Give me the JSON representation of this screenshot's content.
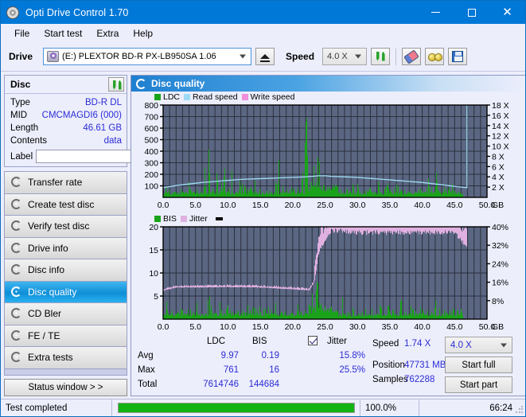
{
  "window": {
    "title": "Opti Drive Control 1.70",
    "icon": "disc-icon",
    "minimize_label": "minimize",
    "maximize_label": "maximize",
    "close_label": "close"
  },
  "menu": {
    "items": [
      "File",
      "Start test",
      "Extra",
      "Help"
    ]
  },
  "toolbar": {
    "drive_label": "Drive",
    "drive_value": "(E:)  PLEXTOR BD-R  PX-LB950SA 1.06",
    "eject_icon": "eject-icon",
    "speed_label": "Speed",
    "speed_value": "4.0 X",
    "refresh_icon": "refresh-icon",
    "erase_icon": "eraser-icon",
    "glasses_icon": "glasses-icon",
    "save_icon": "save-icon"
  },
  "disc": {
    "title": "Disc",
    "refresh_icon": "refresh-icon",
    "rows": [
      {
        "key": "Type",
        "value": "BD-R DL"
      },
      {
        "key": "MID",
        "value": "CMCMAGDI6 (000)"
      },
      {
        "key": "Length",
        "value": "46.61 GB"
      },
      {
        "key": "Contents",
        "value": "data"
      }
    ],
    "label_key": "Label",
    "label_value": "",
    "label_placeholder": "",
    "label_icon": "cd-icon"
  },
  "nav": {
    "items": [
      {
        "label": "Transfer rate",
        "active": false
      },
      {
        "label": "Create test disc",
        "active": false
      },
      {
        "label": "Verify test disc",
        "active": false
      },
      {
        "label": "Drive info",
        "active": false
      },
      {
        "label": "Disc info",
        "active": false
      },
      {
        "label": "Disc quality",
        "active": true
      },
      {
        "label": "CD Bler",
        "active": false
      },
      {
        "label": "FE / TE",
        "active": false
      },
      {
        "label": "Extra tests",
        "active": false
      }
    ],
    "status_window_label": "Status window > >"
  },
  "panel": {
    "title": "Disc quality",
    "icon": "disc-quality-icon"
  },
  "stats": {
    "col_headers": [
      "LDC",
      "BIS"
    ],
    "jitter_label": "Jitter",
    "jitter_checked": true,
    "rows": [
      {
        "key": "Avg",
        "ldc": "9.97",
        "bis": "0.19",
        "jitter": "15.8%"
      },
      {
        "key": "Max",
        "ldc": "761",
        "bis": "16",
        "jitter": "25.5%"
      },
      {
        "key": "Total",
        "ldc": "7614746",
        "bis": "144684",
        "jitter": ""
      }
    ],
    "speed_key": "Speed",
    "speed_value": "1.74 X",
    "position_key": "Position",
    "position_value": "47731 MB",
    "samples_key": "Samples",
    "samples_value": "762288",
    "speed_select_value": "4.0 X",
    "start_full_label": "Start full",
    "start_part_label": "Start part"
  },
  "statusbar": {
    "message": "Test completed",
    "progress_percent": 100,
    "progress_label": "100.0%",
    "elapsed": "66:24"
  },
  "chart_data": [
    {
      "type": "area",
      "id": "ldc-chart",
      "title": "",
      "xlabel": "GB",
      "ylabel": "",
      "xlim": [
        0,
        50
      ],
      "ylim": [
        0,
        800
      ],
      "y2lim": [
        0,
        18
      ],
      "xticks": [
        0.0,
        5.0,
        10.0,
        15.0,
        20.0,
        25.0,
        30.0,
        35.0,
        40.0,
        45.0,
        50.0
      ],
      "xticklabels": [
        "0.0",
        "5.0",
        "10.0",
        "15.0",
        "20.0",
        "25.0",
        "30.0",
        "35.0",
        "40.0",
        "45.0",
        "50.0"
      ],
      "yticks": [
        100,
        200,
        300,
        400,
        500,
        600,
        700,
        800
      ],
      "yticklabels": [
        "100",
        "200",
        "300",
        "400",
        "500",
        "600",
        "700",
        "800"
      ],
      "y2ticks": [
        2,
        4,
        6,
        8,
        10,
        12,
        14,
        16,
        18
      ],
      "y2ticklabels": [
        "2 X",
        "4 X",
        "6 X",
        "8 X",
        "10 X",
        "12 X",
        "14 X",
        "16 X",
        "18 X"
      ],
      "grid": true,
      "plot_bg": "#5b6782",
      "legend": [
        {
          "name": "LDC",
          "color": "#1aa31a"
        },
        {
          "name": "Read speed",
          "color": "#9edcf5"
        },
        {
          "name": "Write speed",
          "color": "#f08fdc"
        }
      ],
      "series": [
        {
          "name": "LDC",
          "kind": "spikes",
          "color": "#1aa31a",
          "x": [
            0.1,
            0.4,
            0.7,
            1.0,
            1.3,
            1.6,
            1.9,
            2.2,
            2.5,
            2.8,
            3.1,
            3.4,
            3.7,
            4.0,
            4.3,
            4.6,
            4.9,
            5.2,
            5.5,
            5.8,
            6.1,
            6.4,
            6.7,
            7.0,
            7.3,
            7.6,
            7.9,
            8.2,
            8.5,
            8.8,
            9.1,
            9.4,
            9.7,
            10.0,
            10.3,
            10.6,
            10.9,
            11.2,
            11.5,
            11.8,
            12.1,
            12.4,
            12.7,
            13.0,
            13.3,
            13.6,
            13.9,
            14.2,
            14.5,
            14.8,
            15.1,
            15.4,
            15.7,
            16.0,
            16.3,
            16.6,
            16.9,
            17.2,
            17.5,
            17.8,
            18.1,
            18.4,
            18.7,
            19.0,
            19.3,
            19.6,
            19.9,
            20.2,
            20.5,
            20.8,
            21.1,
            21.4,
            21.7,
            22.0,
            22.3,
            22.6,
            22.9,
            23.2,
            23.5,
            23.8,
            24.1,
            24.4,
            24.7,
            25.0,
            25.3,
            25.6,
            25.9,
            26.2,
            26.5,
            26.8,
            27.1,
            27.4,
            27.7,
            28.0,
            28.3,
            28.6,
            28.9,
            29.2,
            29.5,
            29.8,
            30.1,
            30.4,
            30.7,
            31.0,
            31.3,
            31.6,
            31.9,
            32.2,
            32.5,
            32.8,
            33.1,
            33.4,
            33.7,
            34.0,
            34.3,
            34.6,
            34.9,
            35.2,
            35.5,
            35.8,
            36.1,
            36.4,
            36.7,
            37.0,
            37.3,
            37.6,
            37.9,
            38.2,
            38.5,
            38.8,
            39.1,
            39.4,
            39.7,
            40.0,
            40.3,
            40.6,
            40.9,
            41.2,
            41.5,
            41.8,
            42.1,
            42.4,
            42.7,
            43.0,
            43.3,
            43.6,
            43.9,
            44.2,
            44.5,
            44.8,
            45.1,
            45.4,
            45.7,
            46.0,
            46.3,
            46.6
          ],
          "values": [
            55,
            120,
            40,
            90,
            35,
            160,
            45,
            70,
            30,
            110,
            40,
            85,
            35,
            200,
            45,
            60,
            30,
            300,
            50,
            75,
            40,
            260,
            55,
            400,
            60,
            90,
            45,
            230,
            50,
            180,
            40,
            300,
            60,
            140,
            35,
            250,
            45,
            80,
            40,
            170,
            50,
            300,
            45,
            95,
            40,
            130,
            55,
            200,
            45,
            100,
            35,
            180,
            50,
            240,
            45,
            90,
            40,
            310,
            55,
            340,
            50,
            120,
            40,
            200,
            60,
            160,
            45,
            110,
            50,
            190,
            45,
            260,
            55,
            700,
            450,
            350,
            760,
            400,
            300,
            650,
            250,
            420,
            160,
            150,
            120,
            90,
            80,
            70,
            100,
            130,
            85,
            95,
            250,
            110,
            70,
            90,
            210,
            160,
            120,
            100,
            230,
            80,
            95,
            70,
            110,
            90,
            130,
            85,
            70,
            75,
            95,
            200,
            80,
            70,
            120,
            260,
            90,
            110,
            75,
            95,
            230,
            200,
            250,
            85,
            70,
            100,
            130,
            160,
            90,
            80,
            110,
            70,
            95,
            140,
            75,
            90,
            210,
            80,
            70,
            100,
            190,
            130,
            85,
            70,
            95,
            120,
            80,
            75,
            110,
            90,
            70,
            85,
            100,
            75,
            60
          ]
        },
        {
          "name": "Read speed",
          "kind": "line",
          "color": "#9edcf5",
          "x": [
            0,
            2,
            4,
            6,
            8,
            10,
            12,
            14,
            16,
            18,
            20,
            22,
            23,
            24,
            25,
            26,
            28,
            30,
            32,
            34,
            36,
            38,
            40,
            42,
            44,
            46,
            46.9,
            46.9
          ],
          "values": [
            1.9,
            2.3,
            2.6,
            2.9,
            3.1,
            3.3,
            3.5,
            3.6,
            3.7,
            3.8,
            3.9,
            4.0,
            4.1,
            4.2,
            4.2,
            4.1,
            4.0,
            3.9,
            3.7,
            3.5,
            3.3,
            3.1,
            2.9,
            2.6,
            2.3,
            2.0,
            1.9,
            18.0
          ]
        }
      ]
    },
    {
      "type": "area",
      "id": "bis-jitter-chart",
      "title": "",
      "xlabel": "GB",
      "ylabel": "",
      "xlim": [
        0,
        50
      ],
      "ylim": [
        0,
        20
      ],
      "y2lim": [
        0,
        40
      ],
      "xticks": [
        0.0,
        5.0,
        10.0,
        15.0,
        20.0,
        25.0,
        30.0,
        35.0,
        40.0,
        45.0,
        50.0
      ],
      "xticklabels": [
        "0.0",
        "5.0",
        "10.0",
        "15.0",
        "20.0",
        "25.0",
        "30.0",
        "35.0",
        "40.0",
        "45.0",
        "50.0"
      ],
      "yticks": [
        5,
        10,
        15,
        20
      ],
      "yticklabels": [
        "5",
        "10",
        "15",
        "20"
      ],
      "y2ticks": [
        8,
        16,
        24,
        32,
        40
      ],
      "y2ticklabels": [
        "8%",
        "16%",
        "24%",
        "32%",
        "40%"
      ],
      "grid": true,
      "plot_bg": "#5b6782",
      "legend": [
        {
          "name": "BIS",
          "color": "#1aa31a"
        },
        {
          "name": "Jitter",
          "color": "#e0b0e0"
        }
      ],
      "series": [
        {
          "name": "BIS",
          "kind": "spikes",
          "color": "#1aa31a",
          "x": [
            0.1,
            0.4,
            0.7,
            1.0,
            1.3,
            1.6,
            1.9,
            2.2,
            2.5,
            2.8,
            3.1,
            3.4,
            3.7,
            4.0,
            4.3,
            4.6,
            4.9,
            5.2,
            5.5,
            5.8,
            6.1,
            6.4,
            6.7,
            7.0,
            7.3,
            7.6,
            7.9,
            8.2,
            8.5,
            8.8,
            9.1,
            9.4,
            9.7,
            10.0,
            10.3,
            10.6,
            10.9,
            11.2,
            11.5,
            11.8,
            12.1,
            12.4,
            12.7,
            13.0,
            13.3,
            13.6,
            13.9,
            14.2,
            14.5,
            14.8,
            15.1,
            15.4,
            15.7,
            16.0,
            16.3,
            16.6,
            16.9,
            17.2,
            17.5,
            17.8,
            18.1,
            18.4,
            18.7,
            19.0,
            19.3,
            19.6,
            19.9,
            20.2,
            20.5,
            20.8,
            21.1,
            21.4,
            21.7,
            22.0,
            22.3,
            22.6,
            22.9,
            23.2,
            23.5,
            23.8,
            24.1,
            24.4,
            24.7,
            25.0,
            25.3,
            25.6,
            25.9,
            26.2,
            26.5,
            26.8,
            27.1,
            27.4,
            27.7,
            28.0,
            28.3,
            28.6,
            28.9,
            29.2,
            29.5,
            29.8,
            30.1,
            30.4,
            30.7,
            31.0,
            31.3,
            31.6,
            31.9,
            32.2,
            32.5,
            32.8,
            33.1,
            33.4,
            33.7,
            34.0,
            34.3,
            34.6,
            34.9,
            35.2,
            35.5,
            35.8,
            36.1,
            36.4,
            36.7,
            37.0,
            37.3,
            37.6,
            37.9,
            38.2,
            38.5,
            38.8,
            39.1,
            39.4,
            39.7,
            40.0,
            40.3,
            40.6,
            40.9,
            41.2,
            41.5,
            41.8,
            42.1,
            42.4,
            42.7,
            43.0,
            43.3,
            43.6,
            43.9,
            44.2,
            44.5,
            44.8,
            45.1,
            45.4,
            45.7,
            46.0,
            46.3,
            46.6
          ],
          "values": [
            2.0,
            3.5,
            2.2,
            2.8,
            1.8,
            4.0,
            2.0,
            2.5,
            1.6,
            3.0,
            1.8,
            2.4,
            1.7,
            5.2,
            2.0,
            2.2,
            1.6,
            5.0,
            2.1,
            2.6,
            1.8,
            4.2,
            2.0,
            6.2,
            2.2,
            2.8,
            1.9,
            4.5,
            2.0,
            3.6,
            1.8,
            5.0,
            2.2,
            3.0,
            1.7,
            4.4,
            1.9,
            2.5,
            1.8,
            3.4,
            2.0,
            5.0,
            1.9,
            2.7,
            1.8,
            3.0,
            2.1,
            4.0,
            1.9,
            2.6,
            1.7,
            3.5,
            2.0,
            4.4,
            1.9,
            2.4,
            1.8,
            5.2,
            2.1,
            5.0,
            2.0,
            2.8,
            1.8,
            3.6,
            2.2,
            3.2,
            1.9,
            2.6,
            2.0,
            3.4,
            1.9,
            4.4,
            2.1,
            7.5,
            6.0,
            5.0,
            7.2,
            6.5,
            5.5,
            6.8,
            5.0,
            5.5,
            3.2,
            3.0,
            2.6,
            2.2,
            2.0,
            1.9,
            2.4,
            2.8,
            2.1,
            2.3,
            5.0,
            2.5,
            1.9,
            2.2,
            4.2,
            3.2,
            2.6,
            2.3,
            4.4,
            2.0,
            2.2,
            1.9,
            2.4,
            2.1,
            2.8,
            2.0,
            1.9,
            1.9,
            2.2,
            4.0,
            2.0,
            1.9,
            2.6,
            5.0,
            2.1,
            2.4,
            1.9,
            2.2,
            4.4,
            4.0,
            4.6,
            2.0,
            1.9,
            2.3,
            2.8,
            3.2,
            2.1,
            2.0,
            2.4,
            1.9,
            2.2,
            2.9,
            1.9,
            2.1,
            4.2,
            2.0,
            1.9,
            2.3,
            3.6,
            2.8,
            2.0,
            1.9,
            2.2,
            2.6,
            2.0,
            1.9,
            2.4,
            2.1,
            1.8,
            2.0,
            2.2,
            1.9,
            1.6
          ]
        },
        {
          "name": "Jitter",
          "kind": "band",
          "color": "#e0b0e0",
          "x": [
            0,
            2,
            5,
            10,
            15,
            20,
            22.5,
            23.2,
            24,
            26,
            30,
            35,
            40,
            45,
            46.9
          ],
          "values": [
            6.3,
            7.0,
            7.0,
            7.1,
            7.0,
            6.6,
            6.4,
            8.0,
            16.2,
            20.5,
            20.0,
            20.0,
            20.0,
            20.0,
            16.5
          ]
        }
      ]
    }
  ]
}
